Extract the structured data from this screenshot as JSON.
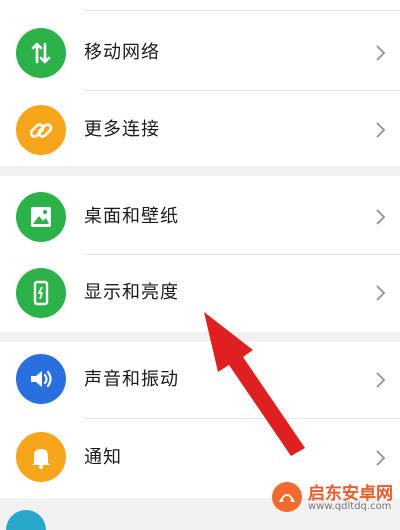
{
  "settings": {
    "items": [
      {
        "label": "移动网络",
        "icon": "mobile-data-icon",
        "color": "#2bb34a"
      },
      {
        "label": "更多连接",
        "icon": "link-icon",
        "color": "#f7a51b"
      },
      {
        "label": "桌面和壁纸",
        "icon": "image-icon",
        "color": "#2bb34a"
      },
      {
        "label": "显示和亮度",
        "icon": "phone-display-icon",
        "color": "#2bb34a"
      },
      {
        "label": "声音和振动",
        "icon": "speaker-icon",
        "color": "#2a6fe0"
      },
      {
        "label": "通知",
        "icon": "bell-icon",
        "color": "#f7a51b"
      }
    ]
  },
  "annotation": {
    "color": "#e02020"
  },
  "watermark": {
    "title": "启东安卓网",
    "url": "www.qdltdq.com"
  }
}
